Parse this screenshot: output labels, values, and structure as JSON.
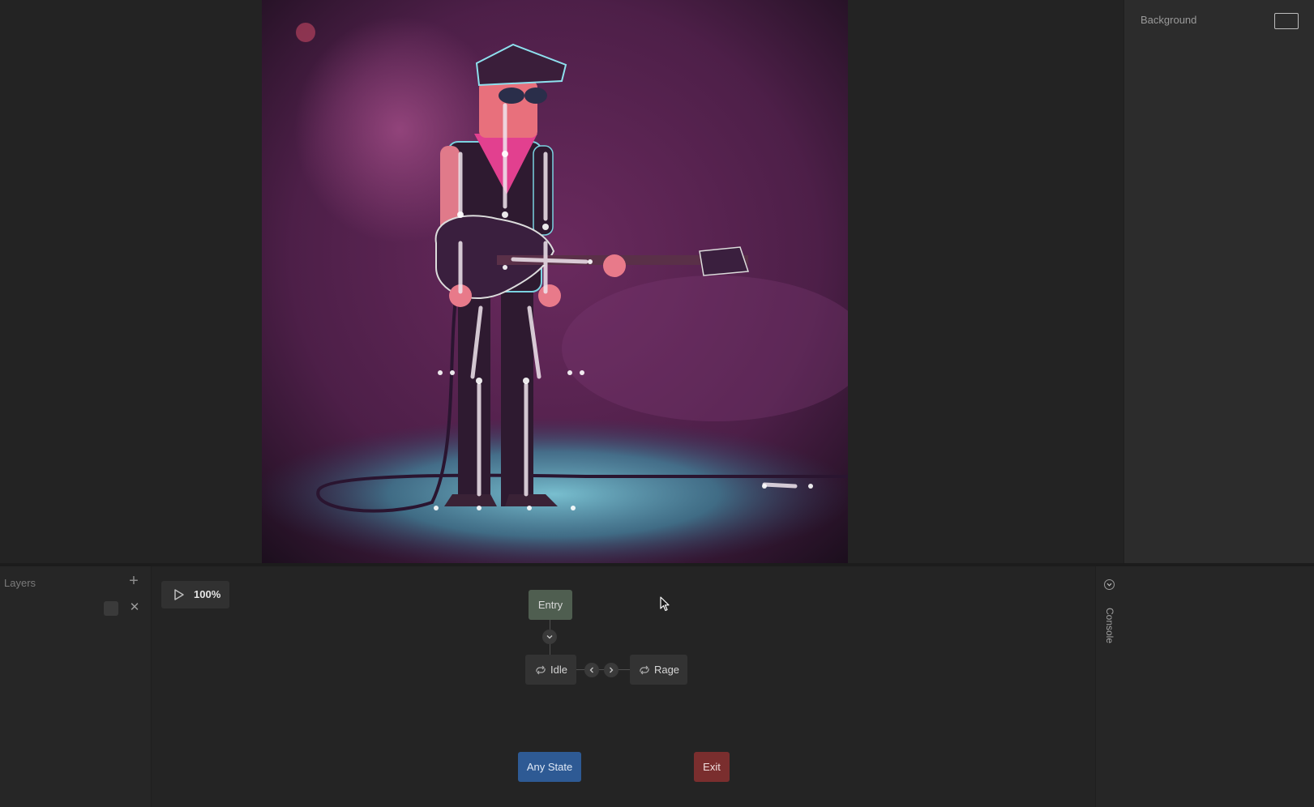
{
  "properties": {
    "background_label": "Background",
    "background_color": "#2c2c2c"
  },
  "layers": {
    "title": "Layers",
    "add_icon": "plus-icon",
    "close_icon": "close-icon"
  },
  "playback": {
    "play_icon": "play-icon",
    "speed": "100%"
  },
  "state_machine": {
    "entry": "Entry",
    "idle": "Idle",
    "rage": "Rage",
    "any_state": "Any State",
    "exit": "Exit"
  },
  "console": {
    "label": "Console"
  },
  "colors": {
    "entry_node": "#4f5e50",
    "any_state_node": "#2e5a94",
    "exit_node": "#7a2e2e",
    "panel": "#262626"
  }
}
